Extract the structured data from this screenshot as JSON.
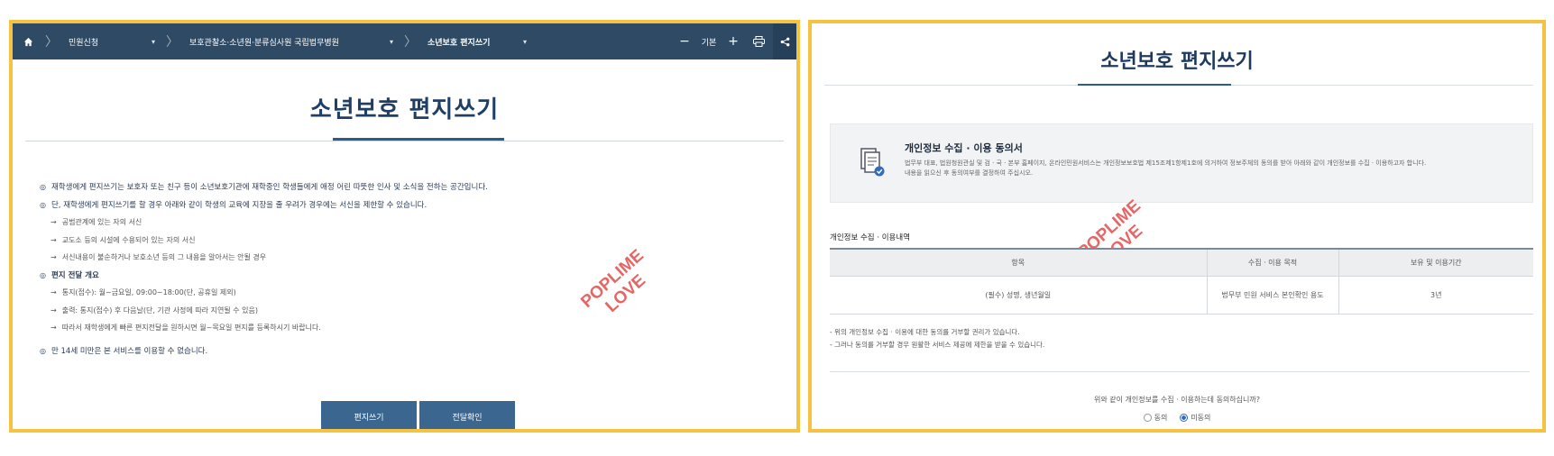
{
  "left": {
    "nav": {
      "crumbs": [
        {
          "label": "민원신청"
        },
        {
          "label": "보호관찰소·소년원·분류심사원 국립법무병원"
        },
        {
          "label": "소년보호 편지쓰기"
        }
      ],
      "minus": "−",
      "font_label": "기본",
      "plus": "+"
    },
    "title": "소년보호 편지쓰기",
    "notice": [
      {
        "type": "b",
        "text": "재학생에게 편지쓰기는 보호자 또는 친구 등이 소년보호기관에 재학중인 학생들에게 애정 어린 따뜻한 인사 및 소식을 전하는 공간입니다."
      },
      {
        "type": "b",
        "text": "단, 재학생에게 편지쓰기를 할 경우 아래와 같이 학생의 교육에 지장을 줄 우려가 경우에는 서신을 제한할 수 있습니다."
      },
      {
        "type": "s",
        "text": "공범관계에 있는 자의 서신"
      },
      {
        "type": "s",
        "text": "교도소 등의 시설에 수용되어 있는 자의 서신"
      },
      {
        "type": "s",
        "text": "서신내용이 불순하거나 보호소년 등의 그 내용을 알아서는 안될 경우"
      },
      {
        "type": "b",
        "text": "편지 전달 개요",
        "bold": true
      },
      {
        "type": "s",
        "text": "통지(접수): 월~금요일, 09:00~18:00(단, 공휴일 제외)"
      },
      {
        "type": "s",
        "text": "출력: 통지(접수) 후 다음날(단, 기관 사정에 따라 지연될 수 있음)"
      },
      {
        "type": "s",
        "text": "따라서 재학생에게 빠른 편지전달을 원하시면 월~목요일 편지를 등록하시기 바랍니다."
      },
      {
        "type": "b",
        "text": "만 14세 미만은 본 서비스를 이용할 수 없습니다."
      }
    ],
    "buttons": {
      "write": "편지쓰기",
      "check": "전달확인"
    },
    "watermark": [
      "POPLIME",
      "LOVE"
    ]
  },
  "right": {
    "title": "소년보호 편지쓰기",
    "consent": {
      "title": "개인정보 수집 · 이용 동의서",
      "desc1": "법무부 대표, 법원청원관실 및 검 · 국 · 본부 홈페이지, 온라인민원서비스는 개인정보보호법 제15조제1항제1호에 의거하여 정보주체의 동의를 받아 아래와 같이 개인정보를 수집 · 이용하고자 합니다.",
      "desc2": "내용을 읽으신 후 동의여부를 결정하여 주십시오."
    },
    "section_label": "개인정보 수집 · 이용내역",
    "table": {
      "headers": [
        "항목",
        "수집 · 이용 목적",
        "보유 및 이용기간"
      ],
      "rows": [
        [
          "(필수) 성명, 생년월일",
          "법무부 민원 서비스 본인확인 용도",
          "3년"
        ]
      ]
    },
    "notes": [
      "- 위의 개인정보 수집 · 이용에 대한 동의를 거부할 권리가 있습니다.",
      "- 그러나 동의를 거부할 경우 원활한 서비스 제공에 제한을 받을 수 있습니다."
    ],
    "question": "위와 같이 개인정보를 수집 · 이용하는데 동의하십니까?",
    "radios": {
      "agree": "동의",
      "disagree": "미동의",
      "selected": "disagree"
    },
    "watermark": [
      "POPLIME",
      "LOVE"
    ]
  },
  "colors": {
    "frame": "#f5c242",
    "nav": "#2f4a64",
    "button": "#3a6690",
    "title": "#1f3f66",
    "watermark": "#e24b4b"
  }
}
